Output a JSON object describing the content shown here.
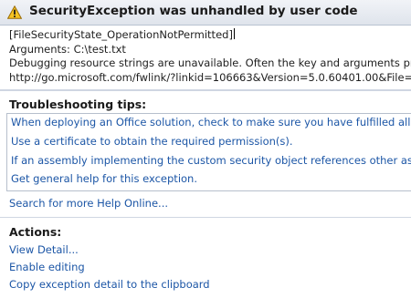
{
  "dialog": {
    "title": "SecurityException was unhandled by user code",
    "icon": "warning-icon",
    "accent_color": "#1c56a6"
  },
  "details": {
    "lines": [
      "[FileSecurityState_OperationNotPermitted]",
      "Arguments: C:\\test.txt",
      "Debugging resource strings are unavailable. Often the key and arguments pro",
      "http://go.microsoft.com/fwlink/?linkid=106663&Version=5.0.60401.00&File="
    ]
  },
  "troubleshooting": {
    "heading": "Troubleshooting tips:",
    "tips": [
      "When deploying an Office solution, check to make sure you have fulfilled all r",
      "Use a certificate to obtain the required permission(s).",
      "If an assembly implementing the custom security object references other ass",
      "Get general help for this exception."
    ],
    "search_link": "Search for more Help Online..."
  },
  "actions": {
    "heading": "Actions:",
    "items": [
      "View Detail...",
      "Enable editing",
      "Copy exception detail to the clipboard"
    ]
  }
}
